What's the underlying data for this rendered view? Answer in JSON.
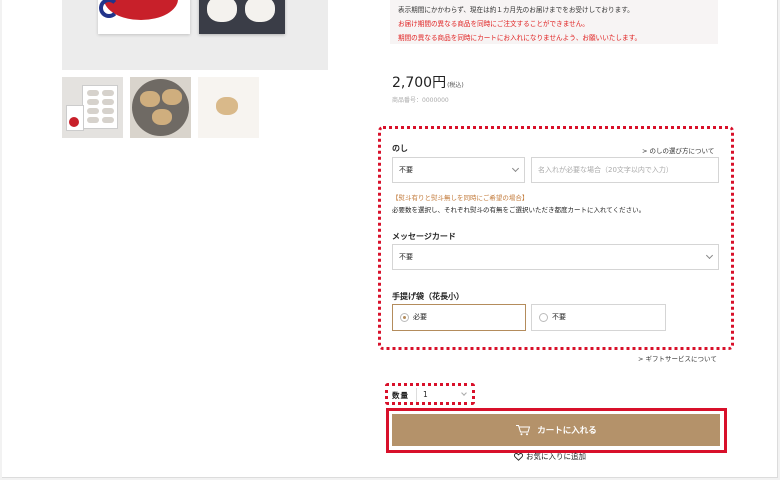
{
  "notice": {
    "line1": "表示期間にかかわらず、現在は約１カ月先のお届けまでをお受けしております。",
    "line2": "お届け期間の異なる商品を同時にご注文することができません。",
    "line3": "期間の異なる商品を同時にカートにお入れになりませんよう、お願いいたします。"
  },
  "price": {
    "amount": "2,700円",
    "tax_note": "(税込)"
  },
  "product_code": "商品番号：0000000",
  "noshi": {
    "label": "のし",
    "guide_link": "のしの選び方について",
    "select_value": "不要",
    "name_placeholder": "名入れが必要な場合（20文字以内で入力）",
    "note_orange": "【熨斗有りと熨斗無しを同時にご希望の場合】",
    "note": "必要数を選択し、それぞれ熨斗の有無をご選択いただき都度カートに入れてください。"
  },
  "message_card": {
    "label": "メッセージカード",
    "select_value": "不要"
  },
  "bag": {
    "label": "手提げ袋（花長小）",
    "options": [
      {
        "label": "必要",
        "selected": true
      },
      {
        "label": "不要",
        "selected": false
      }
    ]
  },
  "gift_service_link": "ギフトサービスについて",
  "quantity": {
    "label": "数量",
    "value": "1"
  },
  "cart_button": "カートに入れる",
  "favorite_link": "お気に入りに追加",
  "colors": {
    "accent": "#b4926a",
    "highlight": "#d8102a",
    "notice_red": "#e02020",
    "note_orange": "#c27a3a"
  },
  "icons": [
    "cart-icon",
    "heart-icon",
    "chevron-down-icon",
    "chevron-right-icon"
  ]
}
